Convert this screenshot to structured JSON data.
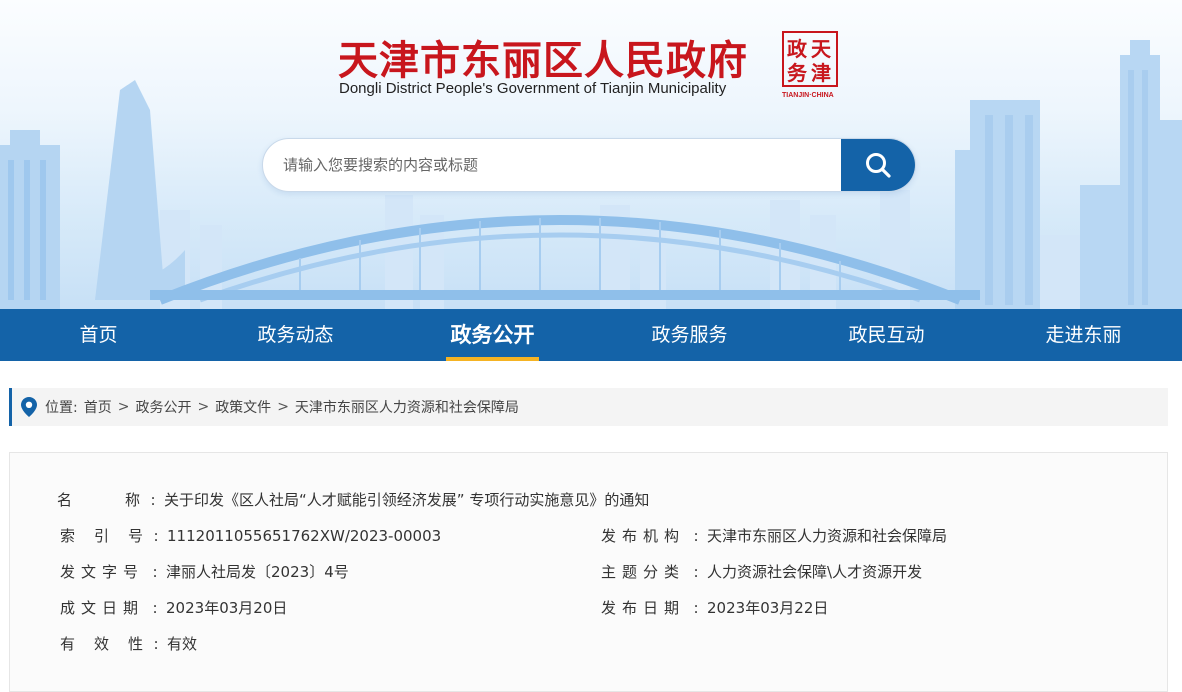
{
  "header": {
    "site_title": "天津市东丽区人民政府",
    "site_subtitle": "Dongli District People's Government of Tianjin Municipality",
    "seal_text": "天津政务网",
    "seal_caption": "TIANJIN·CHINA",
    "brand_color": "#c8161d"
  },
  "search": {
    "placeholder": "请输入您要搜索的内容或标题",
    "value": "",
    "button_icon": "search-icon"
  },
  "nav": {
    "color": "#1463a8",
    "active_indicator_color": "#f5b323",
    "items": [
      {
        "label": "首页",
        "active": false
      },
      {
        "label": "政务动态",
        "active": false
      },
      {
        "label": "政务公开",
        "active": true
      },
      {
        "label": "政务服务",
        "active": false
      },
      {
        "label": "政民互动",
        "active": false
      },
      {
        "label": "走进东丽",
        "active": false
      }
    ]
  },
  "breadcrumb": {
    "icon": "location-pin-icon",
    "prefix": "位置:",
    "items": [
      "首页",
      "政务公开",
      "政策文件",
      "天津市东丽区人力资源和社会保障局"
    ]
  },
  "info": {
    "name": {
      "label": "名　　　称",
      "value": "关于印发《区人社局“人才赋能引领经济发展” 专项行动实施意见》的通知"
    },
    "index_no": {
      "label": "索　引　号",
      "value": "1112011055651762XW/2023-00003"
    },
    "publisher": {
      "label": "发布机构",
      "value": "天津市东丽区人力资源和社会保障局"
    },
    "doc_no": {
      "label": "发文字号",
      "value": "津丽人社局发〔2023〕4号"
    },
    "topic": {
      "label": "主题分类",
      "value": "人力资源社会保障\\人才资源开发"
    },
    "written_date": {
      "label": "成文日期",
      "value": "2023年03月20日"
    },
    "publish_date": {
      "label": "发布日期",
      "value": "2023年03月22日"
    },
    "validity": {
      "label": "有　效　性",
      "value": "有效"
    }
  }
}
